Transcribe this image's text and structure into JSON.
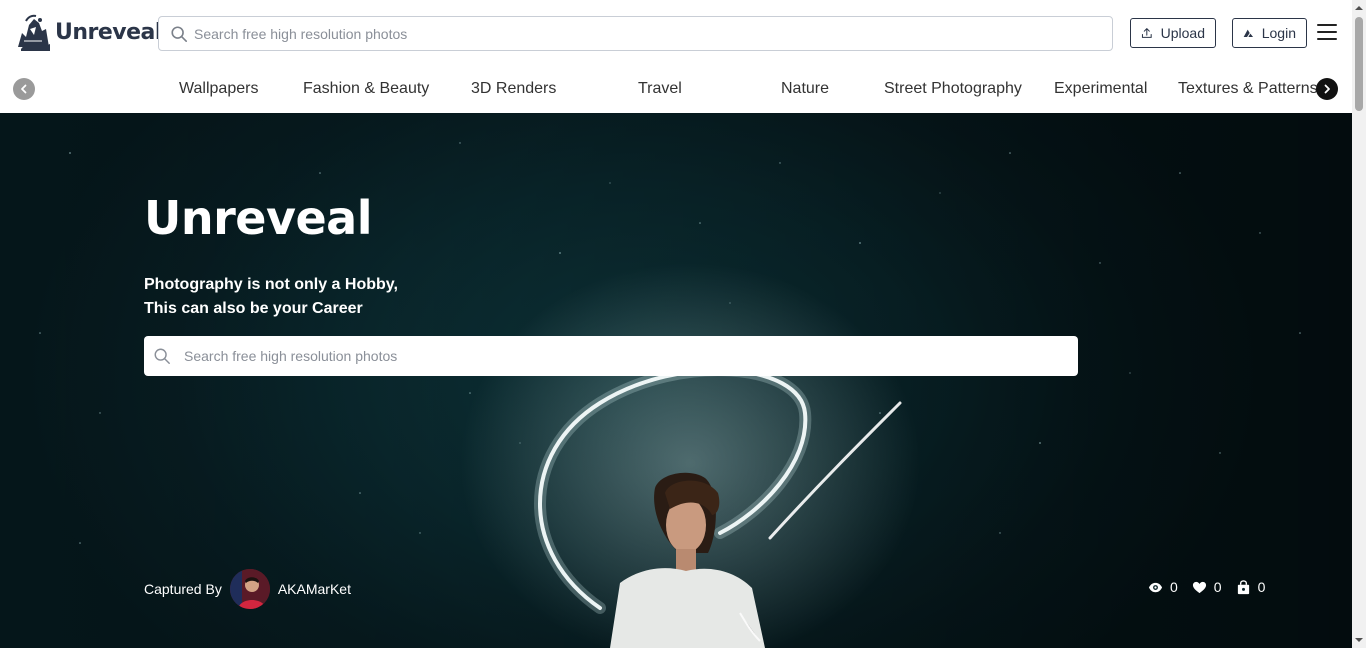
{
  "header": {
    "logo_text": "Unreveal",
    "search_placeholder": "Search free high resolution photos",
    "upload_label": "Upload",
    "login_label": "Login"
  },
  "categories": [
    "Wallpapers",
    "Fashion & Beauty",
    "3D Renders",
    "Travel",
    "Nature",
    "Street Photography",
    "Experimental",
    "Textures & Patterns"
  ],
  "hero": {
    "title": "Unreveal",
    "tagline_line1": "Photography is not only a Hobby,",
    "tagline_line2": "This can also be your Career",
    "search_placeholder": "Search free high resolution photos",
    "credit_label": "Captured By",
    "author": "AKAMarKet",
    "stats": {
      "views": "0",
      "likes": "0",
      "collects": "0"
    }
  },
  "icons": {
    "search": "search-icon",
    "upload": "upload-icon",
    "login": "login-icon",
    "menu": "hamburger-menu-icon",
    "prev": "chevron-left-icon",
    "next": "chevron-right-icon",
    "views": "eye-icon",
    "likes": "heart-icon",
    "collects": "shopping-bag-icon"
  },
  "colors": {
    "brand": "#2b3548",
    "hero_bg": "#071c21",
    "next_arrow": "#111111",
    "prev_arrow": "#9a9a9a"
  }
}
